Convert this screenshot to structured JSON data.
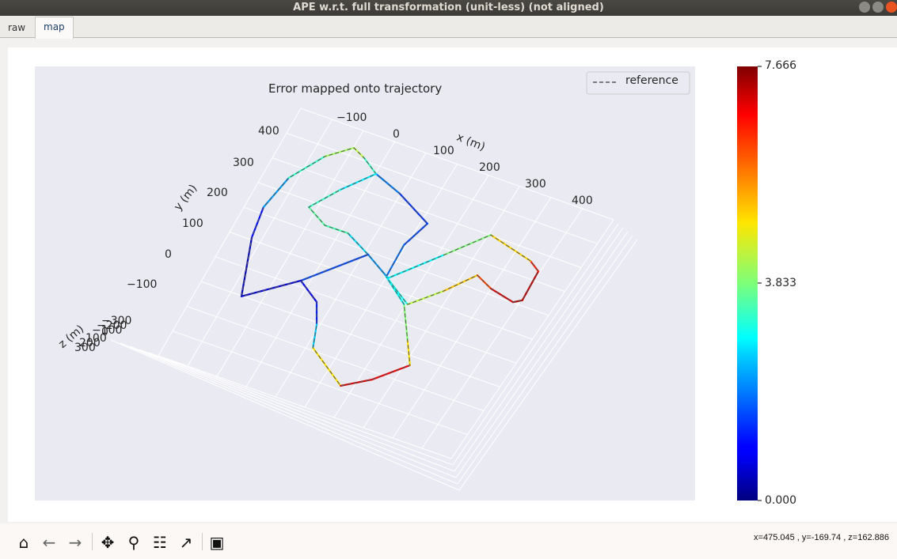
{
  "window": {
    "title": "APE w.r.t. full transformation (unit-less) (not aligned)"
  },
  "tabs": [
    {
      "label": "raw",
      "active": false
    },
    {
      "label": "map",
      "active": true
    }
  ],
  "chart_data": {
    "type": "line",
    "projection": "3d",
    "title": "Error mapped onto trajectory",
    "xlabel": "x (m)",
    "ylabel": "y (m)",
    "zlabel": "z (m)",
    "x_ticks": [
      "−100",
      "0",
      "100",
      "200",
      "300",
      "400"
    ],
    "y_ticks": [
      "400",
      "300",
      "200",
      "100",
      "0",
      "−100"
    ],
    "z_ticks": [
      "−300",
      "−200",
      "−100",
      "0",
      "100",
      "200",
      "300"
    ],
    "legend": {
      "position": "top-right",
      "entries": [
        {
          "name": "reference",
          "style": "dashed",
          "color": "#555555"
        }
      ]
    },
    "grid": true,
    "colormap": "jet",
    "colorbar": {
      "min": 0.0,
      "max": 7.666,
      "ticks": [
        "7.666",
        "3.833",
        "0.000"
      ]
    },
    "trajectory_segments": [
      {
        "x": [
          -31,
          -95,
          -117,
          -115,
          -84,
          -47,
          -16,
          26,
          93,
          181,
          171,
          185,
          259,
          301,
          336,
          377,
          433,
          446,
          433,
          405,
          303,
          251,
          190
        ],
        "y": [
          -47,
          110,
          196,
          292,
          378,
          426,
          410,
          381,
          353,
          303,
          228,
          133,
          83,
          149,
          219,
          198,
          184,
          197,
          284,
          303,
          332,
          238,
          131
        ],
        "error": [
          0.3,
          0.6,
          1.5,
          2.8,
          3.8,
          4.4,
          4.2,
          2.5,
          1.3,
          1.4,
          1.6,
          2.0,
          4.0,
          4.6,
          5.8,
          6.5,
          7.4,
          7.3,
          7.0,
          6.0,
          4.2,
          3.5,
          2.2
        ]
      },
      {
        "x": [
          190,
          124,
          61,
          11,
          -41,
          -12,
          26
        ],
        "y": [
          131,
          172,
          207,
          206,
          237,
          309,
          381
        ],
        "error": [
          2.2,
          2.0,
          3.3,
          3.6,
          3.6,
          3.0,
          2.5
        ]
      },
      {
        "x": [
          124,
          47,
          -31
        ],
        "y": [
          172,
          46,
          -47
        ],
        "error": [
          2.0,
          1.0,
          0.3
        ]
      },
      {
        "x": [
          47,
          103,
          134,
          160,
          259,
          303,
          347,
          308,
          253,
          185
        ],
        "y": [
          46,
          7,
          -49,
          -111,
          -181,
          -137,
          -67,
          -6,
          80,
          133
        ],
        "error": [
          1.0,
          0.8,
          1.5,
          3.5,
          6.5,
          7.5,
          6.0,
          4.0,
          3.8,
          2.0
        ]
      }
    ]
  },
  "toolbar": {
    "buttons": [
      {
        "name": "home",
        "glyph": "⌂"
      },
      {
        "name": "back",
        "glyph": "←"
      },
      {
        "name": "forward",
        "glyph": "→"
      },
      {
        "name": "pan",
        "glyph": "✥"
      },
      {
        "name": "zoom",
        "glyph": "⚲"
      },
      {
        "name": "configure",
        "glyph": "☷"
      },
      {
        "name": "edit-axis",
        "glyph": "↗"
      },
      {
        "name": "save",
        "glyph": "▣"
      }
    ],
    "coords": "x=475.045     , y=-169.74     , z=162.886"
  }
}
